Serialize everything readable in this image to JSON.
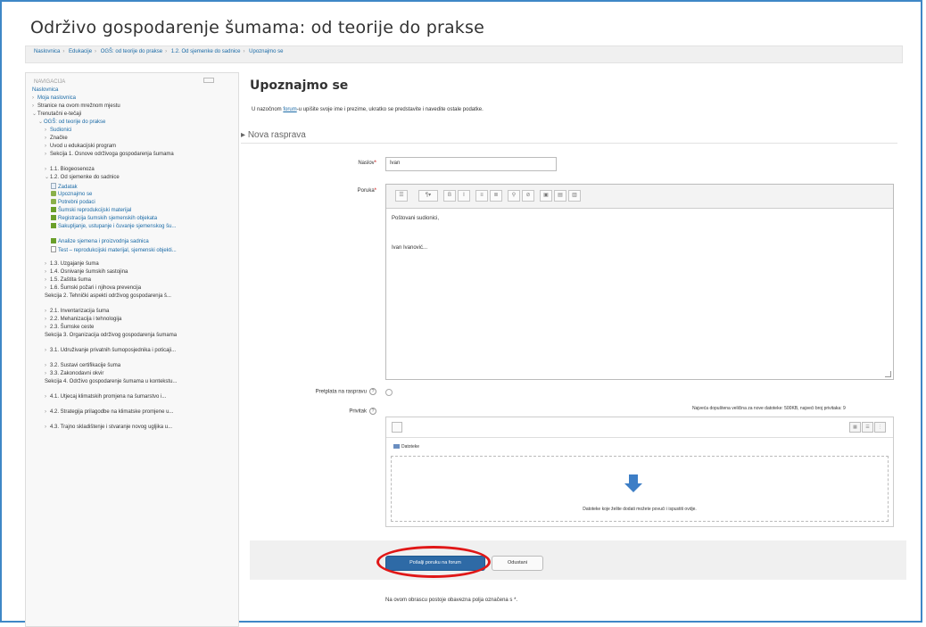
{
  "page": {
    "title": "Održivo gospodarenje šumama: od teorije do prakse",
    "breadcrumbs": [
      "Naslovnica",
      "Edukacije",
      "OGŠ: od teorije do prakse",
      "1.2. Od sjemenke do sadnice",
      "Upoznajmo se"
    ]
  },
  "sidebar": {
    "header": "NAVIGACIJA",
    "items": [
      {
        "label": "Naslovnica",
        "link": true
      },
      {
        "label": "Moja naslovnica",
        "link": true,
        "bullet": "›"
      },
      {
        "label": "Stranice na ovom mrežnom mjestu",
        "bullet": "›"
      },
      {
        "label": "Trenutačni e-tečaji",
        "bullet": "⌄"
      },
      {
        "label": "OGŠ: od teorije do prakse",
        "link": true,
        "bullet": "⌄",
        "indent": 1
      },
      {
        "label": "Sudionici",
        "link": true,
        "bullet": "›",
        "indent": 2
      },
      {
        "label": "Značke",
        "bullet": "›",
        "indent": 2
      },
      {
        "label": "Uvod u edukacijski program",
        "bullet": "›",
        "indent": 2
      },
      {
        "label": "Sekcija 1. Osnove održivoga gospodarenja šumama",
        "bullet": "›",
        "indent": 2,
        "tall": true
      },
      {
        "label": "1.1. Biogeosenoza",
        "bullet": "›",
        "indent": 2
      },
      {
        "label": "1.2. Od sjemenke do sadnice",
        "bullet": "⌄",
        "indent": 2
      },
      {
        "label": "Zadatak",
        "link": true,
        "icon": "page-icon",
        "indent": 3
      },
      {
        "label": "Upoznajmo se",
        "link": true,
        "icon": "forum-icon",
        "indent": 3
      },
      {
        "label": "Potrebni podaci",
        "link": true,
        "icon": "forum-icon",
        "indent": 3
      },
      {
        "label": "Šumski reprodukcijski materijal",
        "link": true,
        "icon": "book-icon",
        "indent": 3
      },
      {
        "label": "Registracija šumskih sjemenskih objekata",
        "link": true,
        "icon": "book-icon",
        "indent": 3
      },
      {
        "label": "Sakupljanje, ustupanje i čuvanje sjemenskog šu...",
        "link": true,
        "icon": "book-icon",
        "indent": 3,
        "tall": true
      },
      {
        "label": "Analize sjemena i proizvodnja sadnica",
        "link": true,
        "icon": "book-icon",
        "indent": 3
      },
      {
        "label": "Test – reprodukcijski materijal, sjemenski objekti...",
        "link": true,
        "icon": "file-icon",
        "indent": 3,
        "tall": true
      },
      {
        "label": "1.3. Uzgajanje šuma",
        "bullet": "›",
        "indent": 2
      },
      {
        "label": "1.4. Osnivanje šumskih sastojina",
        "bullet": "›",
        "indent": 2
      },
      {
        "label": "1.5. Zaštita šuma",
        "bullet": "›",
        "indent": 2
      },
      {
        "label": "1.6. Šumski požari i njihova prevencija",
        "bullet": "›",
        "indent": 2
      },
      {
        "label": "Sekcija 2. Tehnički aspekti održivog gospodarenja š...",
        "indent": 2,
        "tall": true
      },
      {
        "label": "2.1. Inventarizacija šuma",
        "bullet": "›",
        "indent": 2
      },
      {
        "label": "2.2. Mehanizacija i tehnologija",
        "bullet": "›",
        "indent": 2
      },
      {
        "label": "2.3. Šumske ceste",
        "bullet": "›",
        "indent": 2
      },
      {
        "label": "Sekcija 3. Organizacija održivog gospodarenja šumama",
        "indent": 2,
        "tall": true
      },
      {
        "label": "3.1. Udruživanje privatnih šumoposjednika i poticaji...",
        "bullet": "›",
        "indent": 2,
        "tall": true
      },
      {
        "label": "3.2. Sustavi certifikacije šuma",
        "bullet": "›",
        "indent": 2
      },
      {
        "label": "3.3. Zakonodavni okvir",
        "bullet": "›",
        "indent": 2
      },
      {
        "label": "Sekcija 4. Održivo gospodarenje šumama u kontekstu...",
        "indent": 2,
        "tall": true
      },
      {
        "label": "4.1. Utjecaj klimatskih promjena na šumarstvo i...",
        "bullet": "›",
        "indent": 2,
        "tall": true
      },
      {
        "label": "4.2. Strategija prilagodbe na klimatske promjene u...",
        "bullet": "›",
        "indent": 2,
        "tall": true
      },
      {
        "label": "4.3. Trajno skladištenje i stvaranje novog ugljika u...",
        "bullet": "›",
        "indent": 2,
        "tall": true
      }
    ]
  },
  "main": {
    "heading": "Upoznajmo se",
    "intro_prefix": "U nazočnom ",
    "intro_link": "forum",
    "intro_suffix": "-u upišite svoje ime i prezime, ukratko se predstavite i navedite ostale podatke.",
    "legend": "Nova rasprava",
    "subject_label": "Naslov",
    "subject_value": "Ivan",
    "message_label": "Poruka",
    "message_lines": [
      "Poštovani sudionici,",
      "Ivan Ivanović..."
    ],
    "subscribe_label": "Pretplata na raspravu",
    "attachment_label": "Privitak",
    "max_files_note": "Najveća dopuštena veličina za nove datoteke: 500KB, najveći broj privitaka: 9",
    "files_path": "Datoteke",
    "drop_text": "Datoteke koje želite dodati možete povući i ispustiti ovdje.",
    "submit_label": "Pošalji poruku na forum",
    "cancel_label": "Odustani",
    "required_note": "Na ovom obrascu postoje obavezna polja označena s *."
  },
  "colors": {
    "accent": "#2e6aa6",
    "link": "#1a6aa6",
    "highlight": "#e01717",
    "frame": "#3f87c6"
  }
}
